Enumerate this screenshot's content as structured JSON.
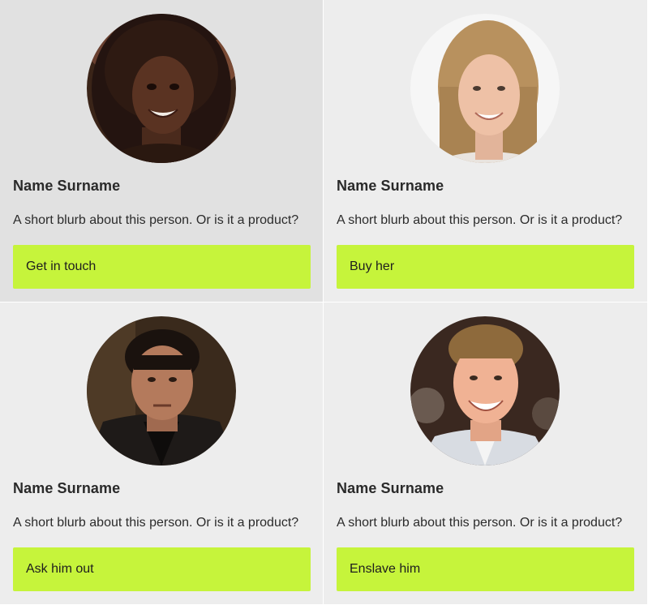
{
  "cards": [
    {
      "name": "Name Surname",
      "blurb": "A short blurb about this person. Or is it a product?",
      "button_label": "Get in touch",
      "avatar_icon": "person-photo-woman-curly-hair"
    },
    {
      "name": "Name Surname",
      "blurb": "A short blurb about this person. Or is it a product?",
      "button_label": "Buy her",
      "avatar_icon": "person-photo-woman-blonde"
    },
    {
      "name": "Name Surname",
      "blurb": "A short blurb about this person. Or is it a product?",
      "button_label": "Ask him out",
      "avatar_icon": "person-photo-man-dark-hair"
    },
    {
      "name": "Name Surname",
      "blurb": "A short blurb about this person. Or is it a product?",
      "button_label": "Enslave him",
      "avatar_icon": "person-photo-man-smiling"
    }
  ],
  "colors": {
    "card_background": "#ededed",
    "card_background_hover": "#e1e1e1",
    "button_accent": "#c6f43b",
    "text": "#222222"
  }
}
